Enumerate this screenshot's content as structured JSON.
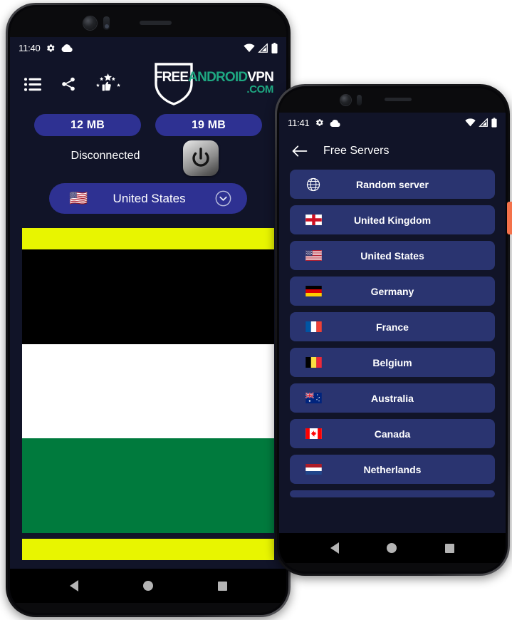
{
  "left_phone": {
    "status_bar": {
      "time": "11:40",
      "icons": [
        "gear-icon",
        "cloud-icon",
        "wifi-icon",
        "signal-icon",
        "battery-icon"
      ]
    },
    "app_bar": {
      "icons": [
        {
          "name": "list-icon",
          "label": "Server list"
        },
        {
          "name": "share-icon",
          "label": "Share"
        },
        {
          "name": "rate-icon",
          "label": "Rate us"
        }
      ],
      "brand": {
        "free": "FREE",
        "android": "ANDROID",
        "vpn": "VPN",
        "com": ".COM"
      }
    },
    "stats": [
      {
        "name": "download-usage",
        "value": "12 MB"
      },
      {
        "name": "upload-usage",
        "value": "19 MB"
      }
    ],
    "connection": {
      "status": "Disconnected",
      "power_button": "power-icon"
    },
    "country_selector": {
      "flag": "🇺🇸",
      "name": "United States",
      "chevron": "chevron-down-icon"
    },
    "banner": {
      "type": "jordan-flag",
      "top_bar_color": "#e8f500",
      "bottom_bar_color": "#e8f500",
      "flag_colors": {
        "black": "#000000",
        "white": "#ffffff",
        "green": "#007a3d",
        "red": "#ce1126"
      },
      "star": "✹"
    },
    "nav_bar": [
      "back-nav-icon",
      "home-nav-icon",
      "recents-nav-icon"
    ]
  },
  "right_phone": {
    "status_bar": {
      "time": "11:41",
      "icons": [
        "gear-icon",
        "cloud-icon",
        "wifi-icon",
        "signal-icon",
        "battery-icon"
      ]
    },
    "app_bar": {
      "back": "back-arrow-icon",
      "title": "Free Servers"
    },
    "servers": [
      {
        "flag": "globe",
        "label": "Random server"
      },
      {
        "flag": "🏴󠁧󠁢󠁥󠁮󠁧󠁿",
        "label": "United Kingdom"
      },
      {
        "flag": "🇺🇸",
        "label": "United States"
      },
      {
        "flag": "🇩🇪",
        "label": "Germany"
      },
      {
        "flag": "🇫🇷",
        "label": "France"
      },
      {
        "flag": "🇧🇪",
        "label": "Belgium"
      },
      {
        "flag": "🇦🇺",
        "label": "Australia"
      },
      {
        "flag": "🇨🇦",
        "label": "Canada"
      },
      {
        "flag": "🇳🇱",
        "label": "Netherlands"
      }
    ],
    "nav_bar": [
      "back-nav-icon",
      "home-nav-icon",
      "recents-nav-icon"
    ]
  },
  "theme": {
    "background": "#111428",
    "accent_blue": "#2e3192",
    "row_blue": "#2a3470",
    "brand_green": "#1ea882",
    "banner_yellow": "#e8f500",
    "side_tab": "#f4714a"
  }
}
